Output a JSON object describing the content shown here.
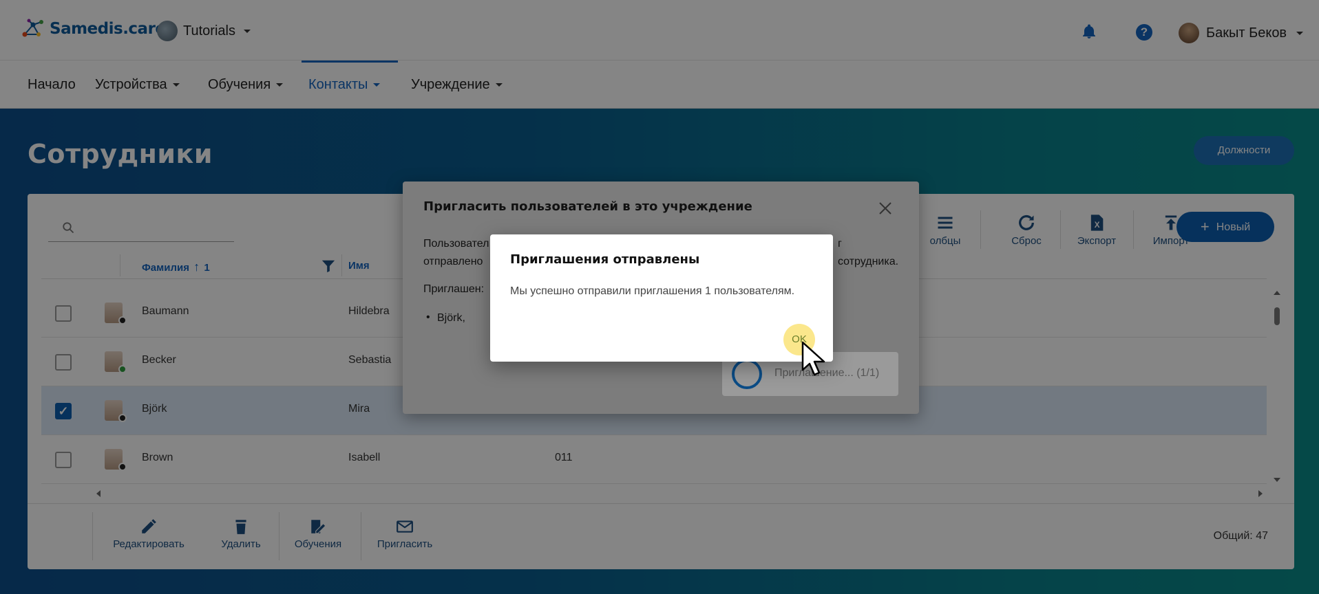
{
  "app": {
    "logo_text": "Samedis.care",
    "tenant": "Tutorials",
    "user_name": "Бакыт Беков",
    "icons": [
      "bell-icon",
      "help-icon"
    ]
  },
  "nav": {
    "items": [
      "Начало",
      "Устройства",
      "Обучения",
      "Контакты",
      "Учреждение"
    ],
    "active": "Контакты"
  },
  "page": {
    "title": "Сотрудники",
    "positions_button": "Должности"
  },
  "toolbar": {
    "columns_label": "Столбцы",
    "columns_visible_fragment": "олбцы",
    "reset_label": "Сброс",
    "export_label": "Экспорт",
    "import_label": "Импорт",
    "new_label": "Новый"
  },
  "table": {
    "headers": {
      "lastname": "Фамилия",
      "sort_index": "1",
      "firstname": "Имя"
    },
    "rows": [
      {
        "lastname": "Baumann",
        "firstname": "Hildebra",
        "extra": "",
        "selected": false,
        "status": "#222222"
      },
      {
        "lastname": "Becker",
        "firstname": "Sebastia",
        "extra": "",
        "selected": false,
        "status": "#2e9e3e"
      },
      {
        "lastname": "Björk",
        "firstname": "Mira",
        "extra": "",
        "selected": true,
        "status": "#222222"
      },
      {
        "lastname": "Brown",
        "firstname": "Isabell",
        "extra": "011",
        "selected": false,
        "status": "#222222"
      }
    ],
    "total": "Общий: 47"
  },
  "actions": {
    "edit": "Редактировать",
    "delete": "Удалить",
    "trainings": "Обучения",
    "invite": "Пригласить"
  },
  "invite_dialog": {
    "title": "Пригласить пользователей в это учреждение",
    "text_line1_start": "Пользовател",
    "text_line1_end": "г",
    "text_line2_start": "отправлено",
    "text_line2_end": "сотрудника.",
    "invited_label": "Приглашен:",
    "invited_item": "Björk,",
    "progress": "Приглашение... (1/1)"
  },
  "success_dialog": {
    "title": "Приглашения отправлены",
    "message": "Мы успешно отправили приглашения 1 пользователям.",
    "ok": "OK"
  },
  "colors": {
    "brand_blue": "#1565c0",
    "hero_start": "#0c4f8c",
    "hero_end": "#0b8d8a",
    "ok_highlight": "#fbe78c"
  }
}
